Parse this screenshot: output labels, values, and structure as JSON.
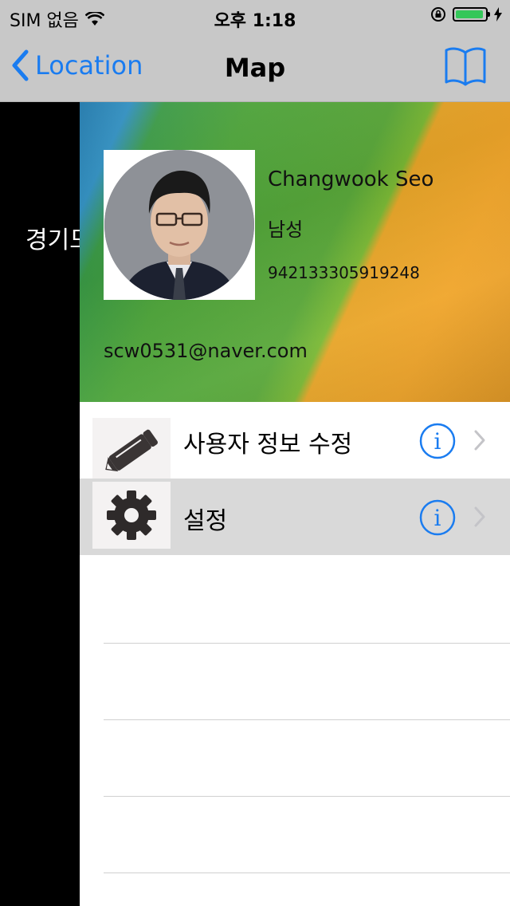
{
  "status": {
    "carrier": "SIM 없음",
    "time": "오후 1:18"
  },
  "nav": {
    "back_label": "Location",
    "title": "Map"
  },
  "underlying": {
    "text": "경기도"
  },
  "profile": {
    "name": "Changwook Seo",
    "gender": "남성",
    "phone": "94213330591924​8",
    "email": "scw0531@naver.com"
  },
  "menu": [
    {
      "label": "사용자 정보 수정",
      "icon": "pencil-icon"
    },
    {
      "label": "설정",
      "icon": "gear-icon"
    }
  ],
  "colors": {
    "accent": "#1a7cf0",
    "bar_bg": "#c8c8c8",
    "selected_row": "#d9d9d9",
    "battery": "#34c759"
  }
}
